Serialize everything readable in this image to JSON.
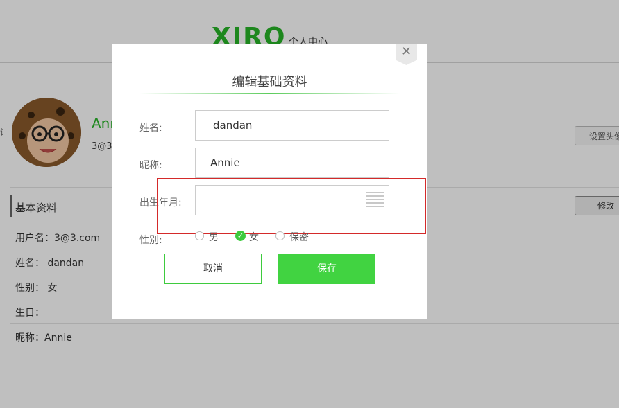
{
  "header": {
    "logo_text": "XIRO",
    "logo_subtitle": "个人中心"
  },
  "profile": {
    "name_partial": "Ann",
    "email_partial": "3@3",
    "set_avatar_button": "设置头像"
  },
  "basic_info": {
    "title": "基本资料",
    "edit_button": "修改",
    "rows": [
      "用户名：3@3.com",
      "姓名： dandan",
      "性别： 女",
      "生日：",
      "昵称：Annie"
    ]
  },
  "modal": {
    "title": "编辑基础资料",
    "close_icon": "close-icon",
    "fields": {
      "name_label": "姓名:",
      "name_value": "dandan",
      "nickname_label": "昵称:",
      "nickname_value": "Annie",
      "birth_label": "出生年月:",
      "birth_value": "",
      "gender_label": "性别:"
    },
    "gender_options": [
      "男",
      "女",
      "保密"
    ],
    "gender_selected": "女",
    "cancel_button": "取消",
    "save_button": "保存"
  },
  "colors": {
    "brand_green": "#27b427",
    "button_green": "#41d341",
    "highlight_red": "#d42a2a"
  }
}
